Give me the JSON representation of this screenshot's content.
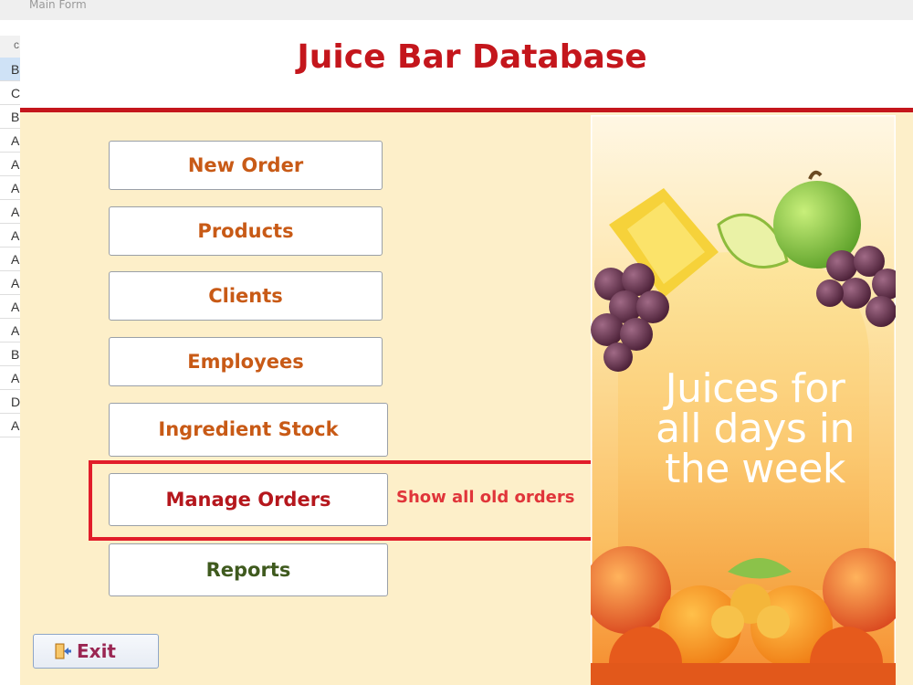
{
  "window": {
    "title": "Main Form"
  },
  "background_sheet": {
    "header": "c",
    "cells": [
      "B",
      "C",
      "B",
      "A",
      "A",
      "A",
      "A",
      "A",
      "A",
      "A",
      "A",
      "A",
      "B",
      "A",
      "D",
      "A"
    ]
  },
  "header": {
    "title": "Juice Bar Database"
  },
  "menu": {
    "new_order": "New Order",
    "products": "Products",
    "clients": "Clients",
    "employees": "Employees",
    "ingredient_stock": "Ingredient Stock",
    "manage_orders": "Manage Orders",
    "reports": "Reports"
  },
  "hint": {
    "text": "Show all old orders"
  },
  "exit": {
    "label": "Exit",
    "icon": "exit-door-icon"
  },
  "promo": {
    "headline": "Juices for all days in the week"
  },
  "colors": {
    "brand_red": "#c4161c",
    "button_text": "#c85a16",
    "manage_orders_text": "#b5171d",
    "reports_text": "#3f5a1e",
    "highlight_red": "#e11d2a",
    "form_background": "#fdefc9"
  }
}
